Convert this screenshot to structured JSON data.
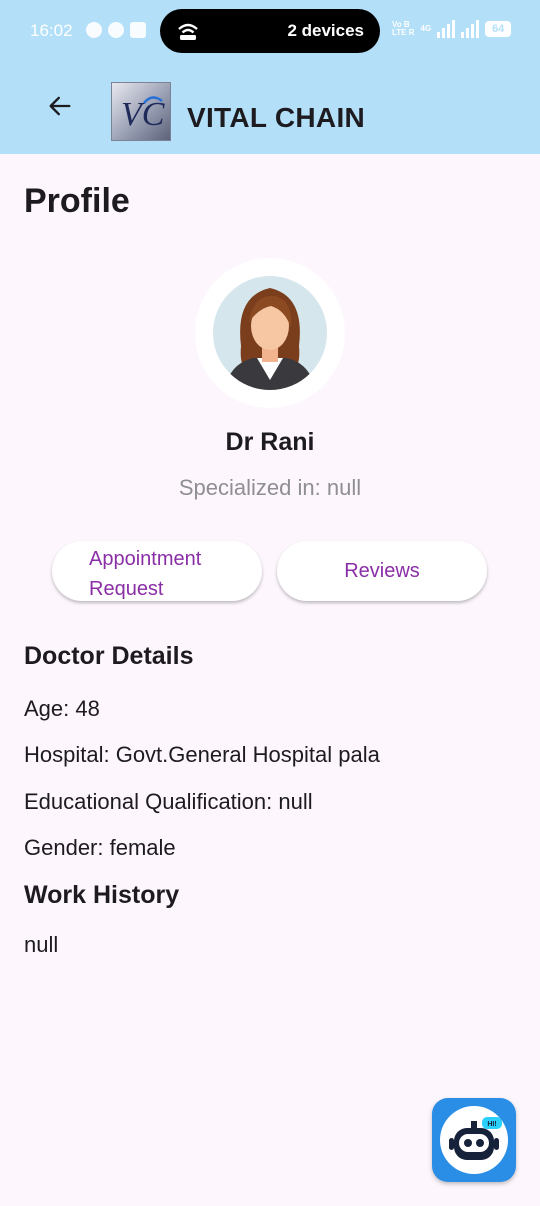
{
  "status_bar": {
    "time": "16:02",
    "pill_text": "2 devices",
    "network_small_1": "Vo B",
    "network_small_2": "LTE R",
    "network_type": "4G",
    "battery": "64"
  },
  "app_bar": {
    "title": "VITAL CHAIN",
    "logo_text": "VC"
  },
  "profile": {
    "page_title": "Profile",
    "name": "Dr Rani",
    "specialized": "Specialized in: null"
  },
  "actions": {
    "appointment_line1": "Appointment",
    "appointment_line2": "Request",
    "reviews": "Reviews"
  },
  "doctor_details": {
    "title": "Doctor Details",
    "age": "Age: 48",
    "hospital": "Hospital: Govt.General Hospital pala",
    "qualification": "Educational Qualification: null",
    "gender": "Gender: female"
  },
  "work_history": {
    "title": "Work History",
    "value": "null"
  },
  "chatbot": {
    "badge": "HI!"
  },
  "colors": {
    "top_bar": "#b3e0f8",
    "background": "#fdf7fd",
    "accent": "#8a2ea6",
    "fab": "#2a8ee6"
  }
}
